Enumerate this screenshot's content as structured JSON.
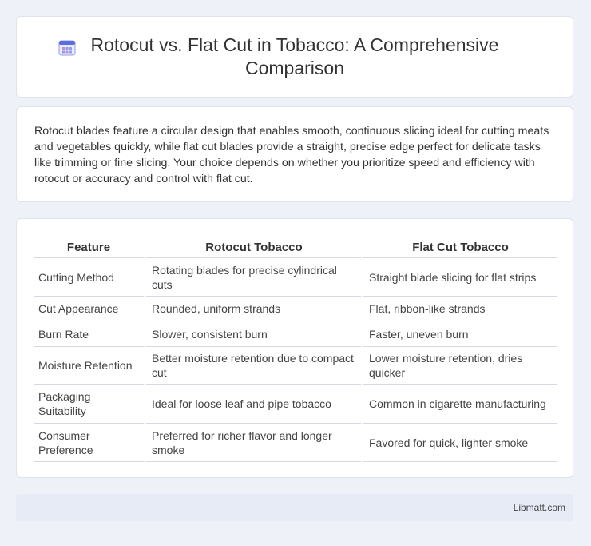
{
  "header": {
    "icon": "calendar-icon",
    "title": "Rotocut vs. Flat Cut in Tobacco: A Comprehensive Comparison"
  },
  "summary": {
    "text": "Rotocut blades feature a circular design that enables smooth, continuous slicing ideal for cutting meats and vegetables quickly, while flat cut blades provide a straight, precise edge perfect for delicate tasks like trimming or fine slicing. Your choice depends on whether you prioritize speed and efficiency with rotocut or accuracy and control with flat cut."
  },
  "table": {
    "headers": [
      "Feature",
      "Rotocut Tobacco",
      "Flat Cut Tobacco"
    ],
    "rows": [
      [
        "Cutting Method",
        "Rotating blades for precise cylindrical cuts",
        "Straight blade slicing for flat strips"
      ],
      [
        "Cut Appearance",
        "Rounded, uniform strands",
        "Flat, ribbon-like strands"
      ],
      [
        "Burn Rate",
        "Slower, consistent burn",
        "Faster, uneven burn"
      ],
      [
        "Moisture Retention",
        "Better moisture retention due to compact cut",
        "Lower moisture retention, dries quicker"
      ],
      [
        "Packaging Suitability",
        "Ideal for loose leaf and pipe tobacco",
        "Common in cigarette manufacturing"
      ],
      [
        "Consumer Preference",
        "Preferred for richer flavor and longer smoke",
        "Favored for quick, lighter smoke"
      ]
    ]
  },
  "footer": {
    "text": "Libmatt.com"
  },
  "colors": {
    "background": "#eef1f8",
    "card": "#ffffff",
    "footer_bg": "#e6ebf6",
    "icon_accent": "#5b6ee1"
  }
}
